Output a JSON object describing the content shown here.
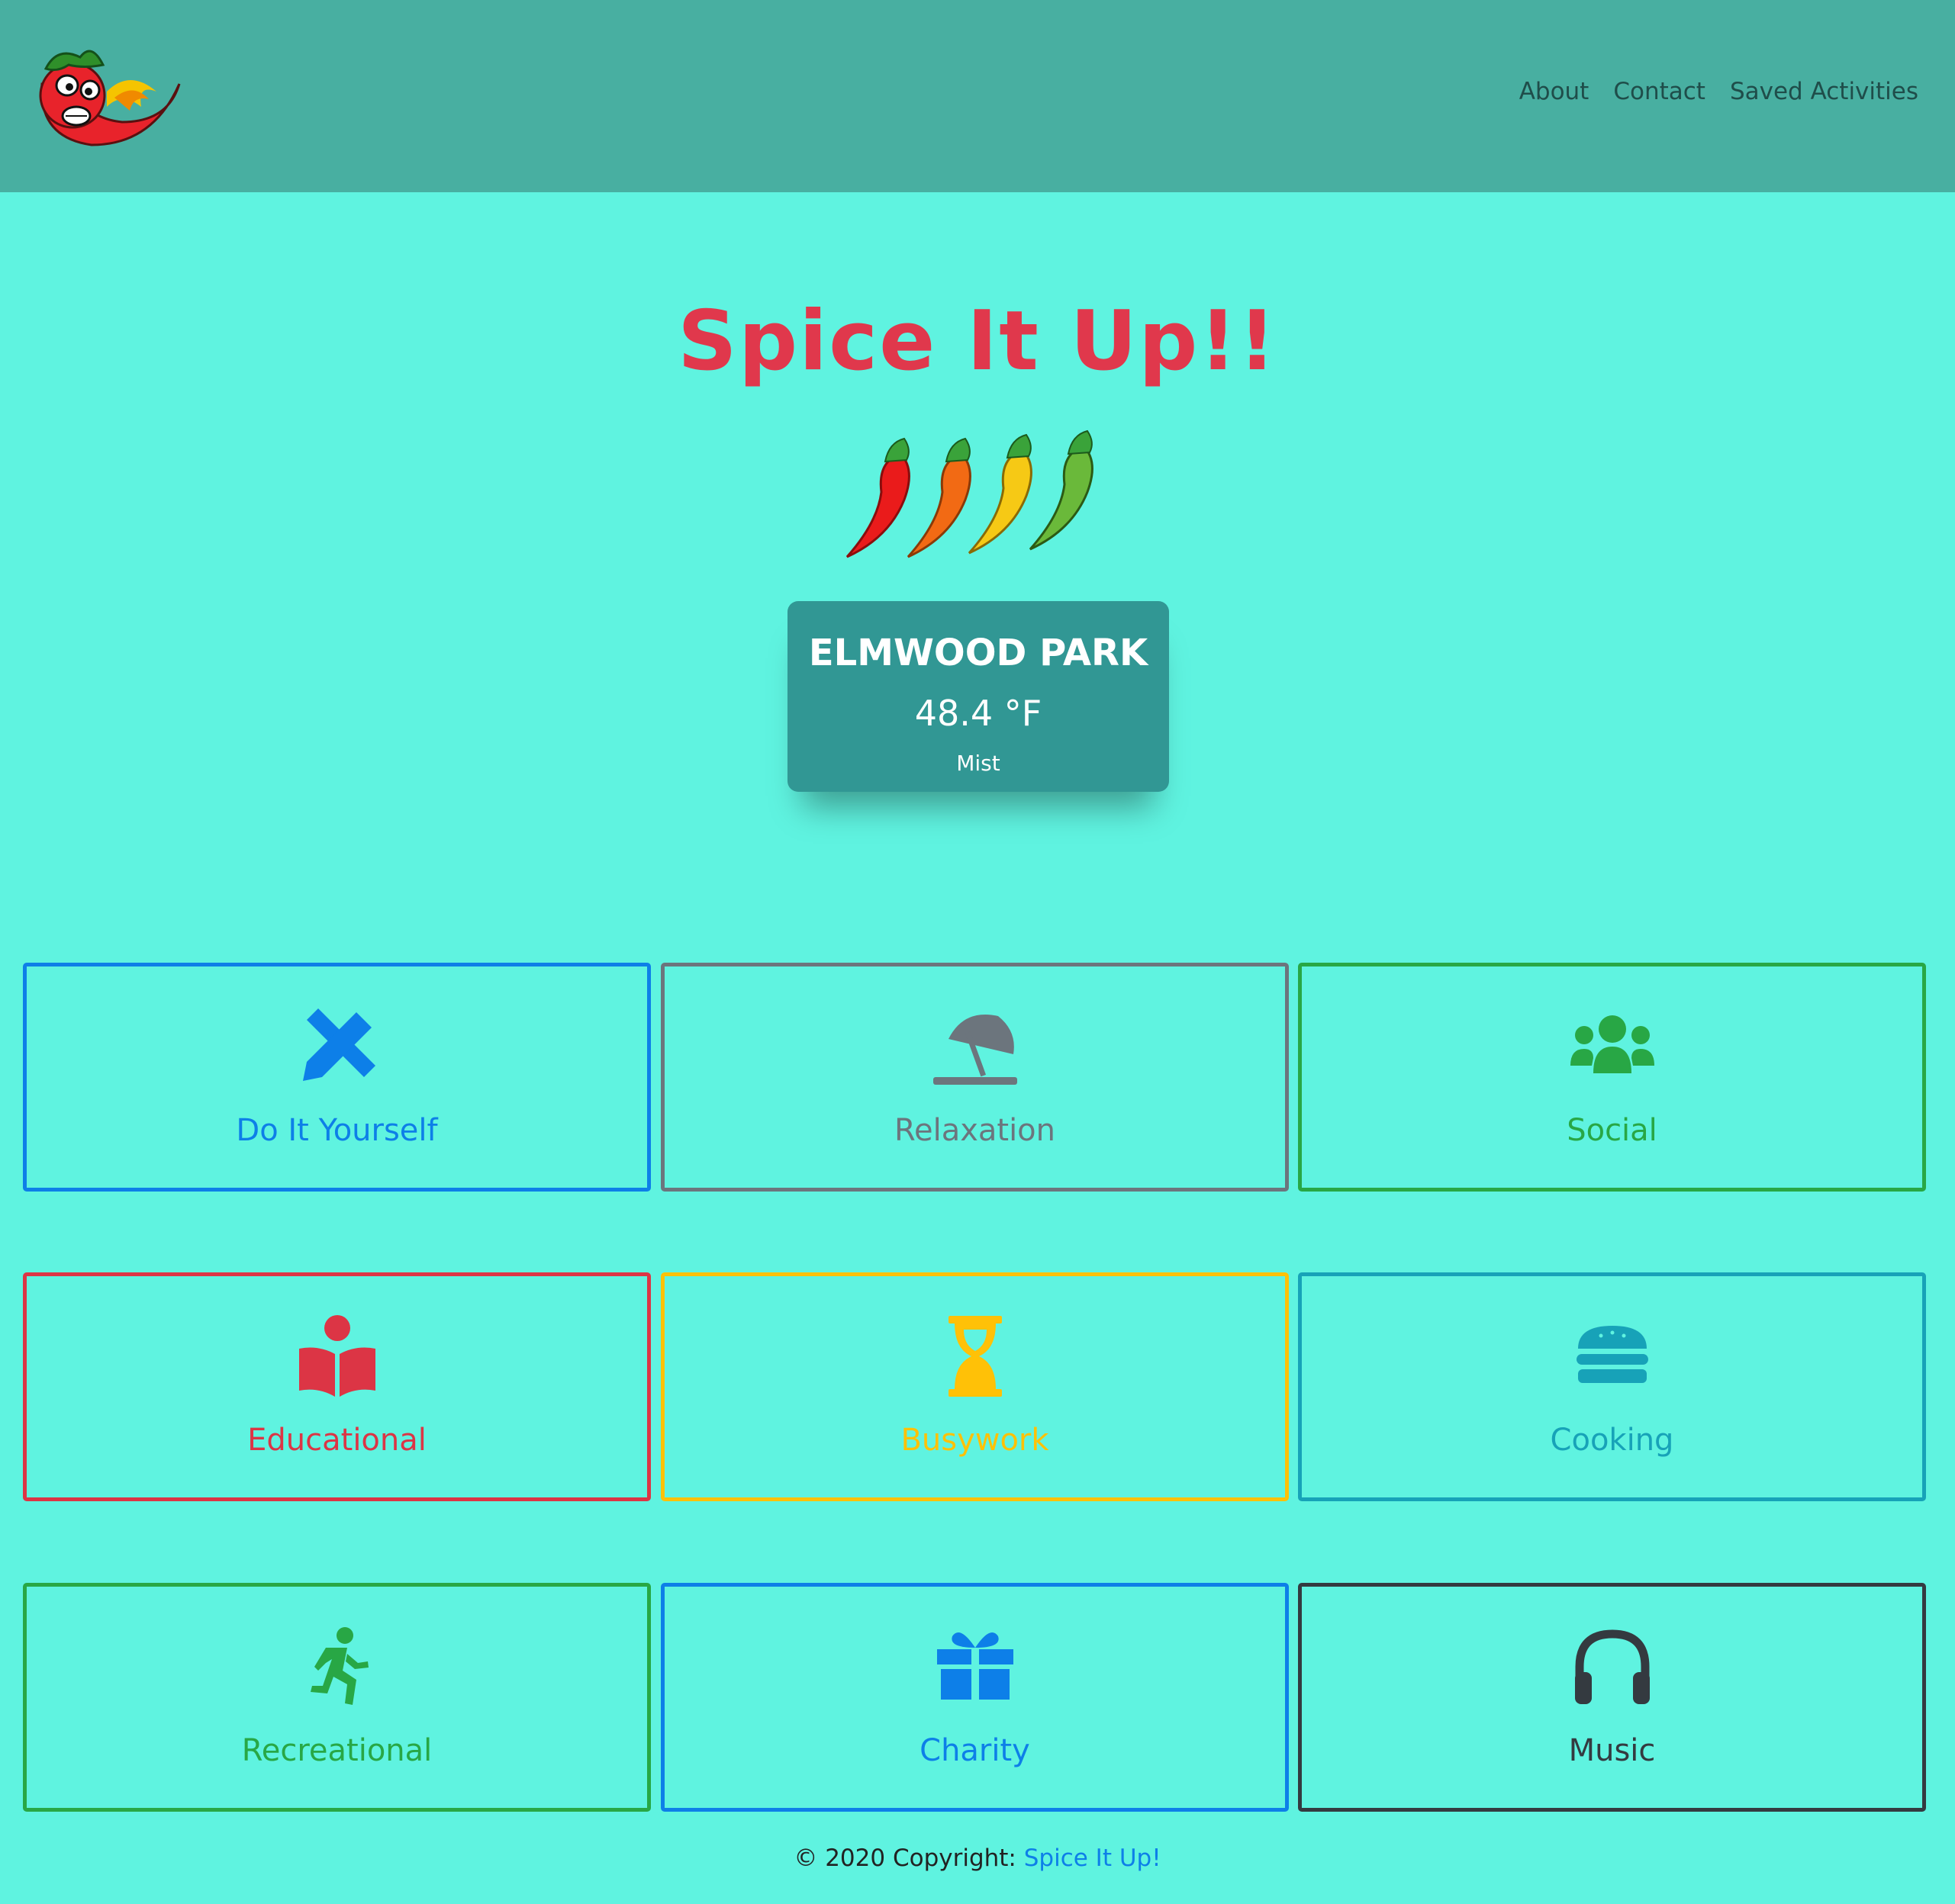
{
  "nav": {
    "links": [
      "About",
      "Contact",
      "Saved Activities"
    ]
  },
  "hero": {
    "title": "Spice It Up!!"
  },
  "weather": {
    "city": "ELMWOOD PARK",
    "temperature": "48.4 °F",
    "description": "Mist"
  },
  "categories": [
    {
      "label": "Do It Yourself",
      "icon": "pencil-ruler-icon",
      "color": "#0d7fe8"
    },
    {
      "label": "Relaxation",
      "icon": "umbrella-beach-icon",
      "color": "#6c757d"
    },
    {
      "label": "Social",
      "icon": "users-icon",
      "color": "#28a745"
    },
    {
      "label": "Educational",
      "icon": "book-reader-icon",
      "color": "#dc3545"
    },
    {
      "label": "Busywork",
      "icon": "hourglass-icon",
      "color": "#ffc107"
    },
    {
      "label": "Cooking",
      "icon": "hamburger-icon",
      "color": "#17a2b8"
    },
    {
      "label": "Recreational",
      "icon": "running-icon",
      "color": "#28a745"
    },
    {
      "label": "Charity",
      "icon": "gift-icon",
      "color": "#0d7fe8"
    },
    {
      "label": "Music",
      "icon": "headphones-icon",
      "color": "#343a40"
    }
  ],
  "footer": {
    "prefix": "© 2020 Copyright: ",
    "link": "Spice It Up!"
  }
}
